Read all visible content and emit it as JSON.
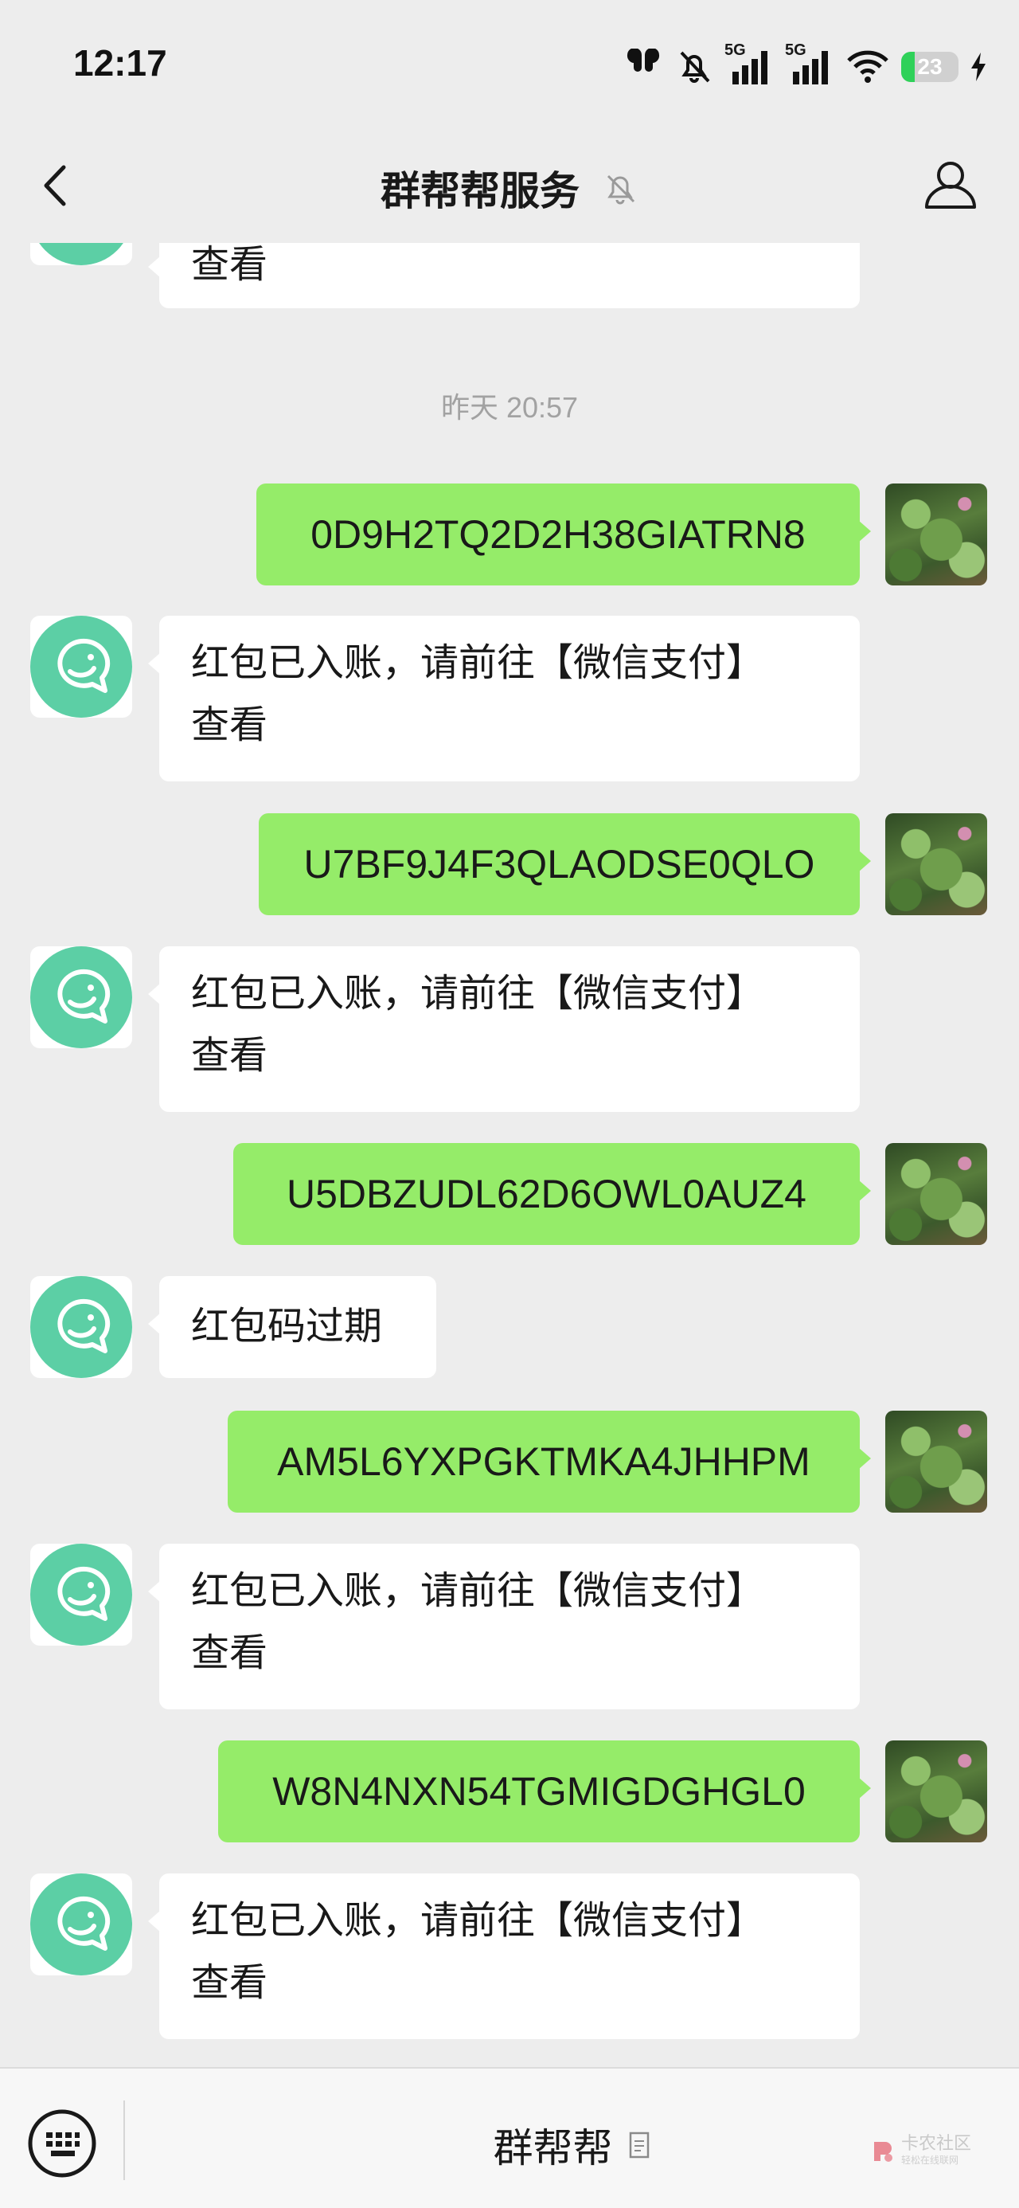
{
  "status_bar": {
    "time": "12:17",
    "network_1": "5G",
    "network_2": "5G",
    "battery_level": "23",
    "battery_fraction": 0.23
  },
  "header": {
    "title": "群帮帮服务",
    "icons": [
      "back-icon",
      "mute-icon",
      "profile-icon"
    ]
  },
  "conversation": {
    "top_partial_message": "查看",
    "timestamp": "昨天 20:57",
    "messages": [
      {
        "sender": "me",
        "text": "0D9H2TQ2D2H38GIATRN8"
      },
      {
        "sender": "bot",
        "line1": "红包已入账，请前往【微信支付】",
        "line2": "查看"
      },
      {
        "sender": "me",
        "text": "U7BF9J4F3QLAODSE0QLO"
      },
      {
        "sender": "bot",
        "line1": "红包已入账，请前往【微信支付】",
        "line2": "查看"
      },
      {
        "sender": "me",
        "text": "U5DBZUDL62D6OWL0AUZ4"
      },
      {
        "sender": "bot",
        "line1": "红包码过期"
      },
      {
        "sender": "me",
        "text": "AM5L6YXPGKTMKA4JHHPM"
      },
      {
        "sender": "bot",
        "line1": "红包已入账，请前往【微信支付】",
        "line2": "查看"
      },
      {
        "sender": "me",
        "text": "W8N4NXN54TGMIGDGHGL0"
      },
      {
        "sender": "bot",
        "line1": "红包已入账，请前往【微信支付】",
        "line2": "查看"
      }
    ]
  },
  "bottom_bar": {
    "menu_label": "群帮帮",
    "watermark_main": "卡农社区",
    "watermark_sub": "轻松在线联网",
    "icons": [
      "keyboard-icon",
      "menu-doc-icon"
    ]
  },
  "colors": {
    "background": "#ededed",
    "my_bubble": "#95ec69",
    "bot_bubble": "#ffffff",
    "bot_avatar": "#5ccfa5",
    "battery": "#2fd159"
  }
}
